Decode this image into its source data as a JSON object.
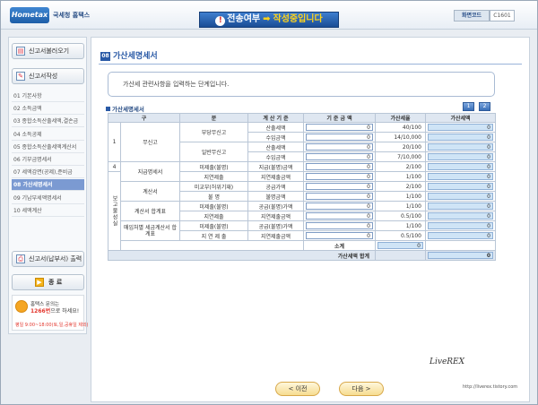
{
  "header": {
    "logo": "Hometax",
    "agency": "국세청 홈택스",
    "banner_left": "전송여부",
    "banner_right": "작성중입니다",
    "screen_code_label": "화면코드",
    "screen_code": "C1601"
  },
  "nav": {
    "load_button": "신고서불러오기",
    "write_button": "신고서작성",
    "items": [
      {
        "label": "01 기본사항",
        "active": false
      },
      {
        "label": "02 소득금액",
        "active": false
      },
      {
        "label": "03 종합소득산출세액,결손금",
        "active": false
      },
      {
        "label": "04 소득공제",
        "active": false
      },
      {
        "label": "05 종합소득산출세액계산서",
        "active": false
      },
      {
        "label": "06 기부금명세서",
        "active": false
      },
      {
        "label": "07 세액감면(공제),준비금",
        "active": false
      },
      {
        "label": "08 가산세명세서",
        "active": true
      },
      {
        "label": "09 기납부세액명세서",
        "active": false
      },
      {
        "label": "10 세액계산",
        "active": false
      }
    ],
    "print_button": "신고서(납부서) 출력",
    "exit_button": "종 료",
    "help_line1": "홈택스 문의는",
    "help_phone": "1266번",
    "help_line2": "으로 하세요!",
    "help_hours": "평일 9:00~18:00(토,일,공휴일 제외)"
  },
  "page": {
    "number": "08",
    "title": "가산세명세서",
    "info": "가산세 관련사항을 입력하는 단계입니다.",
    "section": "가산세명세서",
    "btn1": "1",
    "btn2": "2"
  },
  "table": {
    "headers": [
      "구",
      "분",
      "계 산 기 준",
      "기 준 금 액",
      "가산세율",
      "가산세액"
    ],
    "group1": "1",
    "group4": "4",
    "group_side": "보고불성실",
    "sub_musingo": "무신고",
    "sub_jiguprm": "지급명세서",
    "sub_gyesanseo": "계산서",
    "sub_gyesanseo_total": "계산서 합계표",
    "sub_maeip": "매입처별 세금계산서 합계표",
    "rows": [
      {
        "sub": "부당무신고",
        "basis": "산출세액",
        "amount": "0",
        "rate": "40/100",
        "tax": "0"
      },
      {
        "sub": "",
        "basis": "수입금액",
        "amount": "0",
        "rate": "14/10,000",
        "tax": "0"
      },
      {
        "sub": "일반무신고",
        "basis": "산출세액",
        "amount": "0",
        "rate": "20/100",
        "tax": "0"
      },
      {
        "sub": "",
        "basis": "수입금액",
        "amount": "0",
        "rate": "7/10,000",
        "tax": "0"
      },
      {
        "sub": "미제출(불명)",
        "basis": "지급(불명)금액",
        "amount": "0",
        "rate": "2/100",
        "tax": "0"
      },
      {
        "sub": "지연제출",
        "basis": "지연제출금액",
        "amount": "0",
        "rate": "1/100",
        "tax": "0"
      },
      {
        "sub": "미교부(허위기재)",
        "basis": "공급가액",
        "amount": "0",
        "rate": "2/100",
        "tax": "0"
      },
      {
        "sub": "불 명",
        "basis": "불명금액",
        "amount": "0",
        "rate": "1/100",
        "tax": "0"
      },
      {
        "sub": "미제출(불명)",
        "basis": "공급(불명)가액",
        "amount": "0",
        "rate": "1/100",
        "tax": "0"
      },
      {
        "sub": "지연제출",
        "basis": "지연제출금액",
        "amount": "0",
        "rate": "0.5/100",
        "tax": "0"
      },
      {
        "sub": "미제출(불명)",
        "basis": "공급(불명)가액",
        "amount": "0",
        "rate": "1/100",
        "tax": "0"
      },
      {
        "sub": "지 연 제 출",
        "basis": "지연제출금액",
        "amount": "0",
        "rate": "0.5/100",
        "tax": "0"
      }
    ],
    "subtotal_label": "소계",
    "subtotal_value": "0",
    "total_label": "가산세액 합계",
    "total_value": "0"
  },
  "footer": {
    "prev": "< 이전",
    "next": "다음 >",
    "signature": "LiveREX",
    "signature_url": "http://liverex.tistory.com"
  }
}
